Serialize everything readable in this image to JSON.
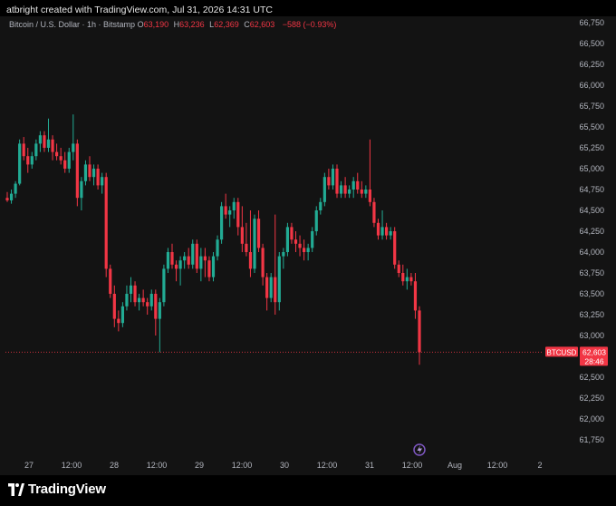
{
  "header": {
    "credit": "atbright created with TradingView.com, Jul 31, 2026 14:31 UTC"
  },
  "legend": {
    "symbol": "Bitcoin / U.S. Dollar · 1h · Bitstamp",
    "o_label": "O",
    "o_value": "63,190",
    "h_label": "H",
    "h_value": "63,236",
    "l_label": "L",
    "l_value": "62,369",
    "c_label": "C",
    "c_value": "62,603",
    "change": "−588 (−0.93%)"
  },
  "price_tag": {
    "symbol": "BTCUSD",
    "price": "62,603",
    "countdown": "28:46",
    "color": "#f23645"
  },
  "footer": {
    "brand": "TradingView"
  },
  "colors": {
    "up": "#22ab94",
    "down": "#f23645",
    "background": "#131313",
    "axis_text": "#b2b5be"
  },
  "icons": {
    "lightning": "lightning-icon"
  },
  "chart_data": {
    "type": "candlestick",
    "title": "Bitcoin / U.S. Dollar · 1h · Bitstamp",
    "ylim": [
      61650,
      66800
    ],
    "y_ticks": [
      66750,
      66500,
      66250,
      66000,
      65750,
      65500,
      65250,
      65000,
      64750,
      64500,
      64250,
      64000,
      63750,
      63500,
      63250,
      63000,
      62750,
      62500,
      62250,
      62000,
      61750
    ],
    "y_tick_labels": [
      "66,750",
      "66,500",
      "66,250",
      "66,000",
      "65,750",
      "65,500",
      "65,250",
      "65,000",
      "64,750",
      "64,500",
      "64,250",
      "64,000",
      "63,750",
      "63,500",
      "63,250",
      "63,000",
      "62,750",
      "62,500",
      "62,250",
      "62,000",
      "61,750"
    ],
    "x_tick_labels": [
      "27",
      "12:00",
      "28",
      "12:00",
      "29",
      "12:00",
      "30",
      "12:00",
      "31",
      "12:00",
      "Aug",
      "12:00",
      "2"
    ],
    "grid": false,
    "candles": [
      [
        64650,
        64720,
        64600,
        64620
      ],
      [
        64620,
        64750,
        64580,
        64700
      ],
      [
        64700,
        64850,
        64650,
        64820
      ],
      [
        64820,
        65350,
        64800,
        65300
      ],
      [
        65300,
        65380,
        65100,
        65150
      ],
      [
        65150,
        65250,
        64950,
        65050
      ],
      [
        65050,
        65200,
        65000,
        65150
      ],
      [
        65150,
        65350,
        65100,
        65300
      ],
      [
        65300,
        65450,
        65200,
        65400
      ],
      [
        65400,
        65450,
        65200,
        65250
      ],
      [
        65250,
        65600,
        65200,
        65350
      ],
      [
        65350,
        65400,
        65100,
        65200
      ],
      [
        65200,
        65300,
        65100,
        65150
      ],
      [
        65150,
        65250,
        65050,
        65100
      ],
      [
        65100,
        65200,
        64950,
        65000
      ],
      [
        65000,
        65250,
        64950,
        65200
      ],
      [
        65200,
        65650,
        65100,
        65300
      ],
      [
        65300,
        65350,
        64550,
        64650
      ],
      [
        64650,
        64900,
        64500,
        64850
      ],
      [
        64850,
        65100,
        64800,
        65050
      ],
      [
        65050,
        65150,
        64850,
        64900
      ],
      [
        64900,
        65050,
        64800,
        65000
      ],
      [
        65000,
        65050,
        64750,
        64800
      ],
      [
        64800,
        64950,
        64700,
        64900
      ],
      [
        64900,
        64950,
        63700,
        63800
      ],
      [
        63800,
        63850,
        63450,
        63500
      ],
      [
        63500,
        63600,
        63100,
        63200
      ],
      [
        63200,
        63300,
        63050,
        63150
      ],
      [
        63150,
        63400,
        63100,
        63350
      ],
      [
        63350,
        63600,
        63300,
        63500
      ],
      [
        63500,
        63700,
        63400,
        63600
      ],
      [
        63600,
        63650,
        63350,
        63400
      ],
      [
        63400,
        63500,
        63300,
        63450
      ],
      [
        63450,
        63550,
        63350,
        63400
      ],
      [
        63400,
        63450,
        63250,
        63350
      ],
      [
        63350,
        63550,
        63300,
        63500
      ],
      [
        63500,
        63550,
        63000,
        63200
      ],
      [
        63200,
        63450,
        62800,
        63400
      ],
      [
        63400,
        63850,
        63350,
        63800
      ],
      [
        63800,
        64050,
        63750,
        64000
      ],
      [
        64000,
        64100,
        63800,
        63850
      ],
      [
        63850,
        63900,
        63650,
        63800
      ],
      [
        63800,
        63950,
        63600,
        63900
      ],
      [
        63900,
        64000,
        63800,
        63950
      ],
      [
        63950,
        64050,
        63800,
        63850
      ],
      [
        63850,
        64150,
        63800,
        64100
      ],
      [
        64100,
        64150,
        63750,
        63800
      ],
      [
        63800,
        64050,
        63650,
        63950
      ],
      [
        63950,
        64050,
        63700,
        63900
      ],
      [
        63900,
        63950,
        63650,
        63700
      ],
      [
        63700,
        64000,
        63650,
        63950
      ],
      [
        63950,
        64200,
        63900,
        64150
      ],
      [
        64150,
        64600,
        64100,
        64550
      ],
      [
        64550,
        64700,
        64400,
        64450
      ],
      [
        64450,
        64550,
        64300,
        64500
      ],
      [
        64500,
        64650,
        64400,
        64600
      ],
      [
        64600,
        64650,
        64200,
        64300
      ],
      [
        64300,
        64550,
        64000,
        64100
      ],
      [
        64100,
        64350,
        63950,
        64000
      ],
      [
        64000,
        64500,
        63700,
        63800
      ],
      [
        63800,
        64450,
        63750,
        64400
      ],
      [
        64400,
        64500,
        64000,
        64050
      ],
      [
        64050,
        64100,
        63600,
        63700
      ],
      [
        63700,
        63750,
        63300,
        63450
      ],
      [
        63450,
        63750,
        63400,
        63700
      ],
      [
        63700,
        64450,
        63250,
        63400
      ],
      [
        63400,
        64000,
        63300,
        63950
      ],
      [
        63950,
        64050,
        63800,
        64000
      ],
      [
        64000,
        64350,
        63950,
        64300
      ],
      [
        64300,
        64350,
        64100,
        64150
      ],
      [
        64150,
        64250,
        64000,
        64100
      ],
      [
        64100,
        64200,
        63950,
        64050
      ],
      [
        64050,
        64150,
        63900,
        64000
      ],
      [
        64000,
        64100,
        63900,
        64050
      ],
      [
        64050,
        64300,
        64000,
        64250
      ],
      [
        64250,
        64550,
        64200,
        64500
      ],
      [
        64500,
        64650,
        64450,
        64600
      ],
      [
        64600,
        64950,
        64550,
        64900
      ],
      [
        64900,
        65000,
        64750,
        64800
      ],
      [
        64800,
        65050,
        64750,
        65000
      ],
      [
        65000,
        65050,
        64650,
        64700
      ],
      [
        64700,
        64850,
        64650,
        64800
      ],
      [
        64800,
        64900,
        64650,
        64700
      ],
      [
        64700,
        64800,
        64650,
        64750
      ],
      [
        64750,
        64900,
        64650,
        64850
      ],
      [
        64850,
        64950,
        64700,
        64750
      ],
      [
        64750,
        64850,
        64650,
        64700
      ],
      [
        64700,
        64800,
        64650,
        64750
      ],
      [
        64750,
        65350,
        64550,
        64600
      ],
      [
        64600,
        64650,
        64300,
        64350
      ],
      [
        64350,
        64400,
        64150,
        64200
      ],
      [
        64200,
        64500,
        64150,
        64300
      ],
      [
        64300,
        64350,
        64150,
        64200
      ],
      [
        64200,
        64300,
        64150,
        64250
      ],
      [
        64250,
        64300,
        63800,
        63850
      ],
      [
        63850,
        63900,
        63700,
        63750
      ],
      [
        63750,
        63850,
        63600,
        63650
      ],
      [
        63650,
        63800,
        63550,
        63700
      ],
      [
        63700,
        63750,
        63600,
        63650
      ],
      [
        63650,
        63750,
        63200,
        63300
      ],
      [
        63300,
        63350,
        62650,
        62800
      ]
    ]
  }
}
